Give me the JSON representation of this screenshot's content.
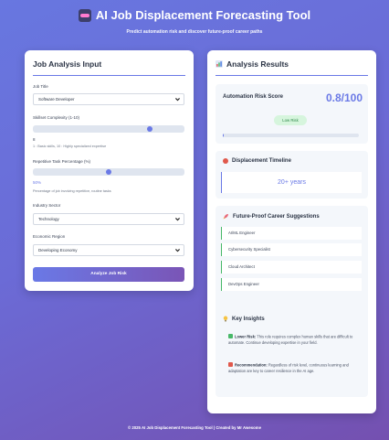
{
  "header": {
    "title": "AI Job Displacement Forecasting Tool",
    "subtitle": "Predict automation risk and discover future-proof career paths"
  },
  "input_panel": {
    "title": "Job Analysis Input",
    "job_title": {
      "label": "Job Title",
      "value": "Software Developer"
    },
    "skillset": {
      "label": "Skillset Complexity (1-10)",
      "value": "8",
      "level_fraction": 0.78,
      "hint": "1 : Basic skills, 10 : Highly specialized expertise"
    },
    "repetitive": {
      "label": "Repetitive Task Percentage (%)",
      "value": "50%",
      "level_fraction": 0.5,
      "hint": "Percentage of job involving repetitive, routine tasks"
    },
    "industry": {
      "label": "Industry Sector",
      "value": "Technology"
    },
    "region": {
      "label": "Economic Region",
      "value": "Developing Economy"
    },
    "button": "Analyze Job Risk"
  },
  "results": {
    "title": "Analysis Results",
    "risk": {
      "label": "Automation Risk Score",
      "score": "0.8/100",
      "badge": "Low Risk",
      "progress_fraction": 0.008
    },
    "timeline": {
      "title": "Displacement Timeline",
      "value": "20+ years"
    },
    "suggestions": {
      "title": "Future-Proof Career Suggestions",
      "items": [
        "AI/ML Engineer",
        "Cybersecurity Specialist",
        "Cloud Architect",
        "DevOps Engineer"
      ]
    },
    "insights": {
      "title": "Key Insights",
      "lower_risk_label": "Lower Risk:",
      "lower_risk_text": "This role requires complex human skills that are difficult to automate. Continue developing expertise in your field.",
      "recommendation_label": "Recommendation:",
      "recommendation_text": "Regardless of risk level, continuous learning and adaptation are key to career resilience in the AI age."
    }
  },
  "footer": "© 2025 AI Job Displacement Forecasting Tool | Created by Mr Awesome",
  "colors": {
    "accent": "#6a79e6",
    "success": "#48b868",
    "badge_bg": "#d6f5dd"
  }
}
